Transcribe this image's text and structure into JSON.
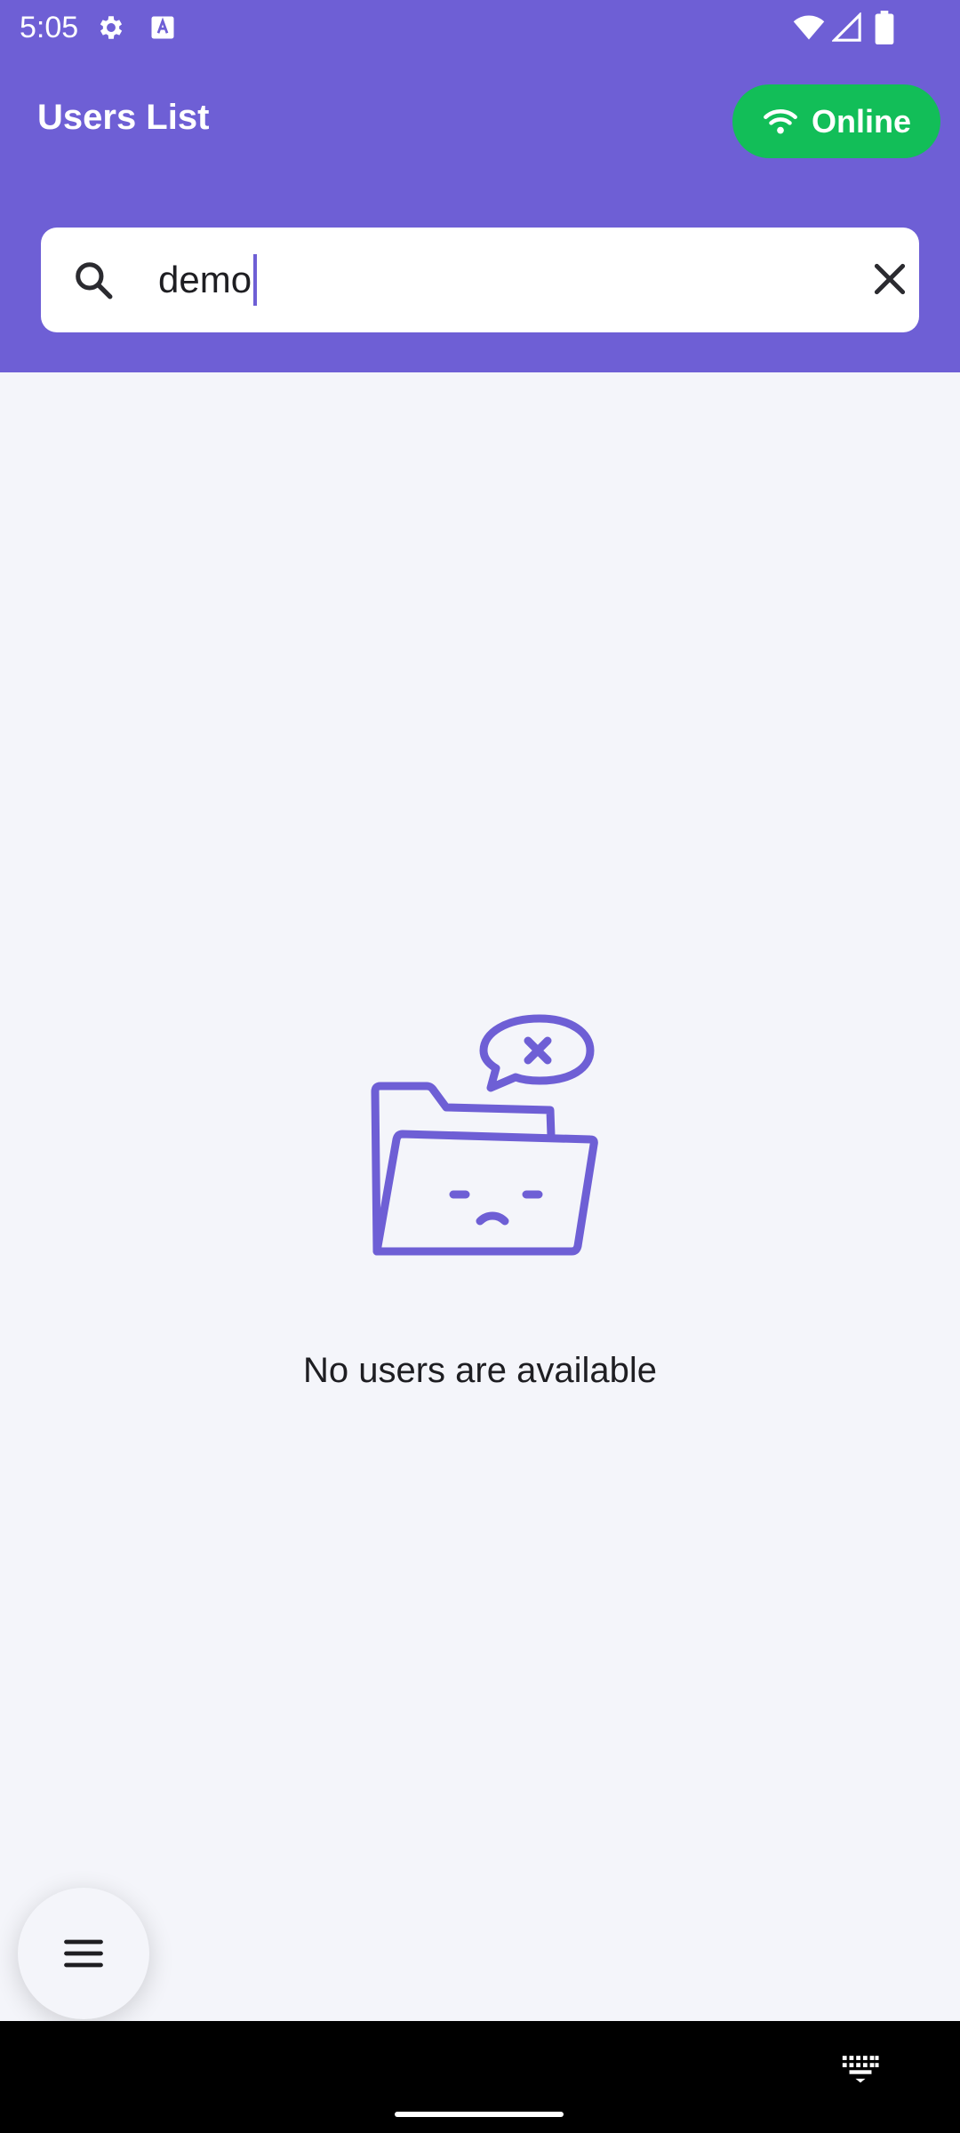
{
  "status_bar": {
    "time": "5:05",
    "icons": [
      "settings-icon",
      "text-a-icon",
      "wifi-icon",
      "signal-icon",
      "battery-icon"
    ]
  },
  "app_bar": {
    "title": "Users List",
    "connection_status": "Online",
    "connection_icon": "wifi-icon",
    "online_color": "#12BE58"
  },
  "search": {
    "value": "demo",
    "icon": "search-icon",
    "clear_icon": "close-icon"
  },
  "empty_state": {
    "icon": "empty-folder-icon",
    "message": "No users are available"
  },
  "fab": {
    "icon": "menu-icon"
  },
  "nav_bar": {
    "icon": "keyboard-icon"
  },
  "colors": {
    "primary": "#6E5FD5",
    "background": "#F4F5FA",
    "success": "#12BE58"
  }
}
